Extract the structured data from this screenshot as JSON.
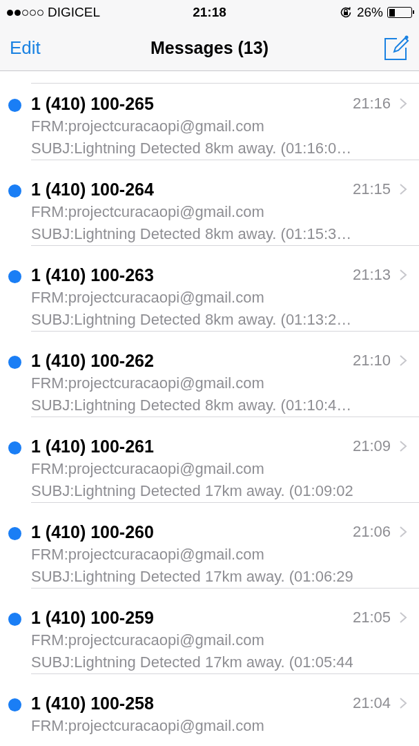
{
  "status_bar": {
    "carrier": "DIGICEL",
    "time": "21:18",
    "battery": "26%"
  },
  "nav": {
    "left": "Edit",
    "title": "Messages (13)"
  },
  "messages": [
    {
      "sender": "1 (410) 100-265",
      "time": "21:16",
      "from": "FRM:projectcuracaopi@gmail.com",
      "subject": "SUBJ:Lightning Detected 8km away. (01:16:0…",
      "unread": true
    },
    {
      "sender": "1 (410) 100-264",
      "time": "21:15",
      "from": "FRM:projectcuracaopi@gmail.com",
      "subject": "SUBJ:Lightning Detected 8km away. (01:15:3…",
      "unread": true
    },
    {
      "sender": "1 (410) 100-263",
      "time": "21:13",
      "from": "FRM:projectcuracaopi@gmail.com",
      "subject": "SUBJ:Lightning Detected 8km away. (01:13:2…",
      "unread": true
    },
    {
      "sender": "1 (410) 100-262",
      "time": "21:10",
      "from": "FRM:projectcuracaopi@gmail.com",
      "subject": "SUBJ:Lightning Detected 8km away. (01:10:4…",
      "unread": true
    },
    {
      "sender": "1 (410) 100-261",
      "time": "21:09",
      "from": "FRM:projectcuracaopi@gmail.com",
      "subject": "SUBJ:Lightning Detected 17km away. (01:09:02",
      "unread": true
    },
    {
      "sender": "1 (410) 100-260",
      "time": "21:06",
      "from": "FRM:projectcuracaopi@gmail.com",
      "subject": "SUBJ:Lightning Detected 17km away. (01:06:29",
      "unread": true
    },
    {
      "sender": "1 (410) 100-259",
      "time": "21:05",
      "from": "FRM:projectcuracaopi@gmail.com",
      "subject": "SUBJ:Lightning Detected 17km away. (01:05:44",
      "unread": true
    },
    {
      "sender": "1 (410) 100-258",
      "time": "21:04",
      "from": "FRM:projectcuracaopi@gmail.com",
      "unread": true
    }
  ]
}
